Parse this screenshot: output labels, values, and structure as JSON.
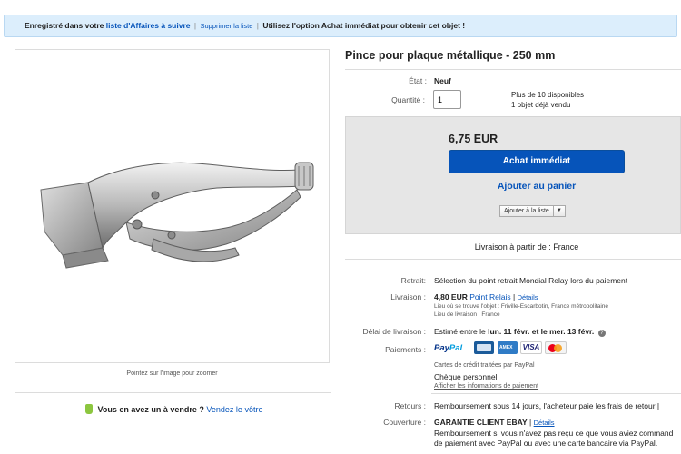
{
  "banner": {
    "prefix": "Enregistré dans votre",
    "watchlist_link": "liste d'Affaires à suivre",
    "remove_link": "Supprimer la liste",
    "suffix": "Utilisez l'option Achat immédiat pour obtenir cet objet !"
  },
  "image": {
    "zoom_hint": "Pointez sur l'image pour zoomer"
  },
  "sell": {
    "prompt": "Vous en avez un à vendre ?",
    "link": "Vendez le vôtre"
  },
  "item": {
    "title": "Pince pour plaque métallique - 250 mm",
    "condition_label": "État :",
    "condition_value": "Neuf",
    "quantity_label": "Quantité :",
    "quantity_value": "1",
    "available": "Plus de 10 disponibles",
    "sold_link": "1 objet déjà vendu"
  },
  "buy": {
    "price": "6,75 EUR",
    "buy_now": "Achat immédiat",
    "add_to_cart": "Ajouter au panier",
    "add_to_list": "Ajouter à la liste"
  },
  "delivery": {
    "ships_from": "Livraison à partir de : France"
  },
  "details": {
    "pickup_label": "Retrait:",
    "pickup_value": "Sélection du point retrait Mondial Relay lors du paiement",
    "shipping_label": "Livraison :",
    "shipping_price": "4,80 EUR",
    "shipping_method": "Point Relais",
    "shipping_details_link": "Détails",
    "item_location": "Lieu où se trouve l'objet :  Friville-Escarbotin, France métropolitaine",
    "ship_to": "Lieu de livraison :  France",
    "delay_label": "Délai de livraison :",
    "delay_prefix": "Estimé entre le",
    "delay_dates": "lun. 11 févr. et le mer. 13 févr.",
    "payments_label": "Paiements :",
    "paypal_pay": "Pay",
    "paypal_pal": "Pal",
    "visa": "VISA",
    "amex": "AMEX",
    "cards_note": "Cartes de crédit traitées par PayPal",
    "cheque": "Chèque personnel",
    "payment_info_link": "Afficher les informations de paiement",
    "returns_label": "Retours :",
    "returns_value": "Remboursement sous 14 jours, l'acheteur paie les frais de retour |",
    "coverage_label": "Couverture :",
    "coverage_title": "GARANTIE CLIENT EBAY",
    "coverage_link": "Détails",
    "coverage_text_1": "Remboursement si vous n'avez pas reçu ce que vous aviez command",
    "coverage_text_2": "de paiement avec PayPal ou avec une carte bancaire via PayPal."
  }
}
